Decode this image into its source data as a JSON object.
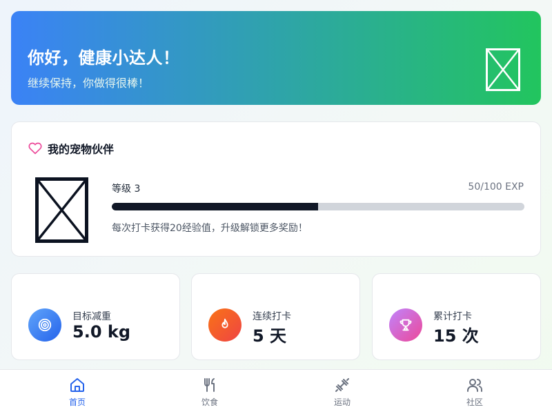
{
  "banner": {
    "greeting": "你好，健康小达人！",
    "subtitle": "继续保持，你做得很棒！",
    "gradient_start": "#3b82f6",
    "gradient_end": "#22c55e"
  },
  "pet": {
    "title": "我的宠物伙伴",
    "heart_color": "#ec4899",
    "level_label": "等级 3",
    "exp_text": "50/100 EXP",
    "exp_progress": 0.5,
    "hint": "每次打卡获得20经验值，升级解锁更多奖励！"
  },
  "stats": [
    {
      "label": "目标减重",
      "value": "5.0 kg",
      "icon": "target-icon",
      "colors": [
        "#60a5fa",
        "#2563eb"
      ]
    },
    {
      "label": "连续打卡",
      "value": "5 天",
      "icon": "flame-icon",
      "colors": [
        "#f97316",
        "#ef4444"
      ]
    },
    {
      "label": "累计打卡",
      "value": "15 次",
      "icon": "trophy-icon",
      "colors": [
        "#c084fc",
        "#ec4899"
      ]
    }
  ],
  "nav": {
    "items": [
      {
        "label": "首页",
        "icon": "home-icon",
        "active": true
      },
      {
        "label": "饮食",
        "icon": "utensils-icon",
        "active": false
      },
      {
        "label": "运动",
        "icon": "dumbbell-icon",
        "active": false
      },
      {
        "label": "社区",
        "icon": "users-icon",
        "active": false
      }
    ],
    "active_color": "#2563eb",
    "inactive_color": "#6b7280"
  }
}
